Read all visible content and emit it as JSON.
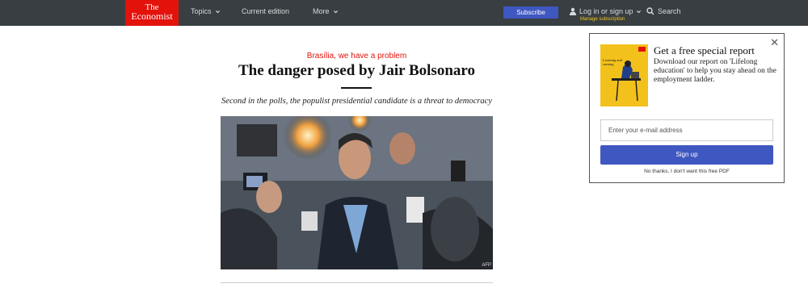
{
  "nav": {
    "logo_line1": "The",
    "logo_line2": "Economist",
    "topics": "Topics",
    "current_edition": "Current edition",
    "more": "More",
    "subscribe": "Subscribe",
    "login": "Log in or sign up",
    "manage_subscription": "Manage subscription",
    "search": "Search"
  },
  "article": {
    "flytitle": "Brasília, we have a problem",
    "headline": "The danger posed by Jair Bolsonaro",
    "rubric": "Second in the polls, the populist presidential candidate is a threat to democracy",
    "image_credit": "AFP"
  },
  "popup": {
    "cover_title_line1": "Learning and",
    "cover_title_line2": "earning",
    "title": "Get a free special report",
    "description": "Download our report on 'Lifelong education' to help you stay ahead on the employment ladder.",
    "email_placeholder": "Enter your e-mail address",
    "signup_label": "Sign up",
    "no_thanks": "No thanks, I don't want this free PDF"
  },
  "colors": {
    "brand_red": "#e3120b",
    "nav_bg": "#383e42",
    "button_blue": "#3f57c0",
    "manage_yellow": "#f2c71f",
    "cover_yellow": "#f3c11c"
  }
}
